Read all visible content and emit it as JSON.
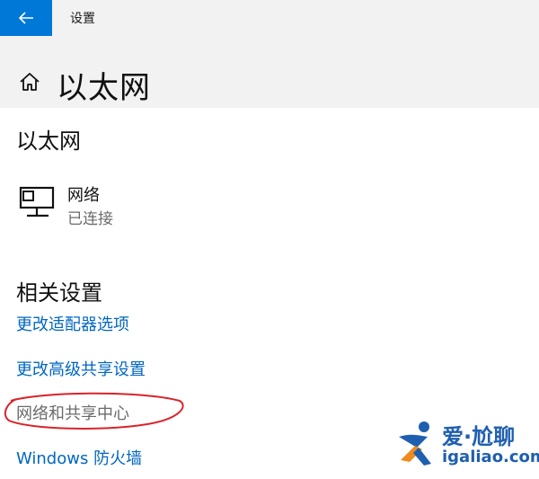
{
  "window": {
    "title": "设置"
  },
  "header": {
    "title": "以太网"
  },
  "ethernet_section": {
    "title": "以太网",
    "network": {
      "name": "网络",
      "status": "已连接"
    }
  },
  "related": {
    "title": "相关设置",
    "links": [
      {
        "label": "更改适配器选项"
      },
      {
        "label": "更改高级共享设置"
      },
      {
        "label": "网络和共享中心"
      },
      {
        "label": "Windows 防火墙"
      }
    ]
  },
  "watermark": {
    "brand": "爱·尬聊",
    "domain": "igaliao.com"
  },
  "colors": {
    "accent": "#0078d7",
    "link": "#0067c0",
    "annotation": "#d9232a",
    "watermark_blue": "#1f5fb0",
    "watermark_orange": "#f08a1c"
  },
  "icons": [
    "back-arrow-icon",
    "home-icon",
    "network-computer-icon"
  ]
}
